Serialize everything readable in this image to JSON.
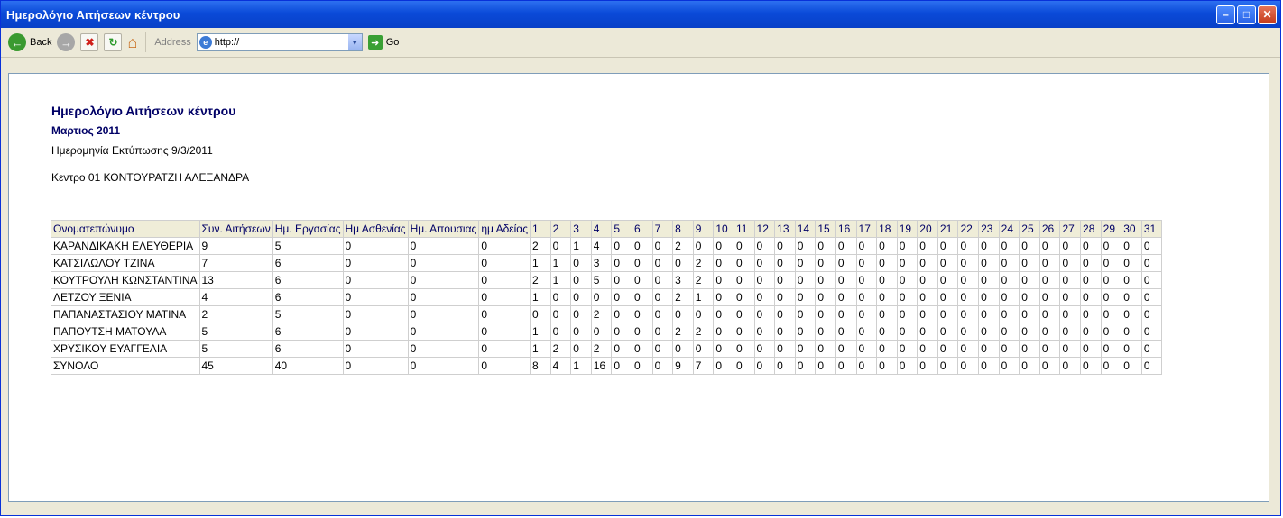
{
  "window": {
    "title": "Ημερολόγιο Αιτήσεων κέντρου"
  },
  "toolbar": {
    "back_label": "Back",
    "address_label": "Address",
    "address_value": "http://",
    "go_label": "Go"
  },
  "report": {
    "title": "Ημερολόγιο Αιτήσεων κέντρου",
    "month": "Μαρτιος 2011",
    "print_date": "Ημερομηνία Εκτύπωσης 9/3/2011",
    "center": "Κεντρο 01 ΚΟΝΤΟΥΡΑΤΖΗ ΑΛΕΞΑΝΔΡΑ"
  },
  "table": {
    "headers": [
      "Ονοματεπώνυμο",
      "Συν. Αιτήσεων",
      "Ημ. Εργασίας",
      "Ημ Ασθενίας",
      "Ημ. Απουσιας",
      "ημ Αδείας",
      "1",
      "2",
      "3",
      "4",
      "5",
      "6",
      "7",
      "8",
      "9",
      "10",
      "11",
      "12",
      "13",
      "14",
      "15",
      "16",
      "17",
      "18",
      "19",
      "20",
      "21",
      "22",
      "23",
      "24",
      "25",
      "26",
      "27",
      "28",
      "29",
      "30",
      "31"
    ],
    "rows": [
      [
        "ΚΑΡΑΝΔΙΚΑΚΗ ΕΛΕΥΘΕΡΙΑ",
        "9",
        "5",
        "0",
        "0",
        "0",
        "2",
        "0",
        "1",
        "4",
        "0",
        "0",
        "0",
        "2",
        "0",
        "0",
        "0",
        "0",
        "0",
        "0",
        "0",
        "0",
        "0",
        "0",
        "0",
        "0",
        "0",
        "0",
        "0",
        "0",
        "0",
        "0",
        "0",
        "0",
        "0",
        "0",
        "0"
      ],
      [
        "ΚΑΤΣΙΛΩΛΟΥ ΤΖΙΝΑ",
        "7",
        "6",
        "0",
        "0",
        "0",
        "1",
        "1",
        "0",
        "3",
        "0",
        "0",
        "0",
        "0",
        "2",
        "0",
        "0",
        "0",
        "0",
        "0",
        "0",
        "0",
        "0",
        "0",
        "0",
        "0",
        "0",
        "0",
        "0",
        "0",
        "0",
        "0",
        "0",
        "0",
        "0",
        "0",
        "0"
      ],
      [
        "ΚΟΥΤΡΟΥΛΗ ΚΩΝΣΤΑΝΤΙΝΑ",
        "13",
        "6",
        "0",
        "0",
        "0",
        "2",
        "1",
        "0",
        "5",
        "0",
        "0",
        "0",
        "3",
        "2",
        "0",
        "0",
        "0",
        "0",
        "0",
        "0",
        "0",
        "0",
        "0",
        "0",
        "0",
        "0",
        "0",
        "0",
        "0",
        "0",
        "0",
        "0",
        "0",
        "0",
        "0",
        "0"
      ],
      [
        "ΛΕΤΖΟΥ ΞΕΝΙΑ",
        "4",
        "6",
        "0",
        "0",
        "0",
        "1",
        "0",
        "0",
        "0",
        "0",
        "0",
        "0",
        "2",
        "1",
        "0",
        "0",
        "0",
        "0",
        "0",
        "0",
        "0",
        "0",
        "0",
        "0",
        "0",
        "0",
        "0",
        "0",
        "0",
        "0",
        "0",
        "0",
        "0",
        "0",
        "0",
        "0"
      ],
      [
        "ΠΑΠΑΝΑΣΤΑΣΙΟΥ ΜΑΤΙΝΑ",
        "2",
        "5",
        "0",
        "0",
        "0",
        "0",
        "0",
        "0",
        "2",
        "0",
        "0",
        "0",
        "0",
        "0",
        "0",
        "0",
        "0",
        "0",
        "0",
        "0",
        "0",
        "0",
        "0",
        "0",
        "0",
        "0",
        "0",
        "0",
        "0",
        "0",
        "0",
        "0",
        "0",
        "0",
        "0",
        "0"
      ],
      [
        "ΠΑΠΟΥΤΣΗ ΜΑΤΟΥΛΑ",
        "5",
        "6",
        "0",
        "0",
        "0",
        "1",
        "0",
        "0",
        "0",
        "0",
        "0",
        "0",
        "2",
        "2",
        "0",
        "0",
        "0",
        "0",
        "0",
        "0",
        "0",
        "0",
        "0",
        "0",
        "0",
        "0",
        "0",
        "0",
        "0",
        "0",
        "0",
        "0",
        "0",
        "0",
        "0",
        "0"
      ],
      [
        "ΧΡΥΣΙΚΟΥ ΕΥΑΓΓΕΛΙΑ",
        "5",
        "6",
        "0",
        "0",
        "0",
        "1",
        "2",
        "0",
        "2",
        "0",
        "0",
        "0",
        "0",
        "0",
        "0",
        "0",
        "0",
        "0",
        "0",
        "0",
        "0",
        "0",
        "0",
        "0",
        "0",
        "0",
        "0",
        "0",
        "0",
        "0",
        "0",
        "0",
        "0",
        "0",
        "0",
        "0"
      ],
      [
        "ΣΥΝΟΛΟ",
        "45",
        "40",
        "0",
        "0",
        "0",
        "8",
        "4",
        "1",
        "16",
        "0",
        "0",
        "0",
        "9",
        "7",
        "0",
        "0",
        "0",
        "0",
        "0",
        "0",
        "0",
        "0",
        "0",
        "0",
        "0",
        "0",
        "0",
        "0",
        "0",
        "0",
        "0",
        "0",
        "0",
        "0",
        "0",
        "0"
      ]
    ]
  }
}
